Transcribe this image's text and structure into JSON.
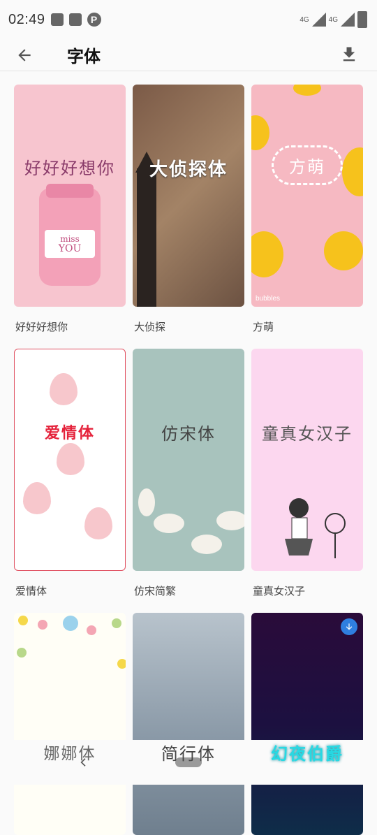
{
  "status_bar": {
    "time": "02:49",
    "network_1": "4G",
    "network_2": "4G"
  },
  "app_bar": {
    "title": "字体",
    "back_icon": "arrow-left-icon",
    "download_icon": "download-icon"
  },
  "fonts": [
    {
      "label": "好好好想你",
      "sample": "好好好想你"
    },
    {
      "label": "大侦探",
      "sample": "大侦探体"
    },
    {
      "label": "方萌",
      "sample": "方萌"
    },
    {
      "label": "爱情体",
      "sample": "爱情体"
    },
    {
      "label": "仿宋简繁",
      "sample": "仿宋体"
    },
    {
      "label": "童真女汉子",
      "sample": "童真女汉子"
    },
    {
      "label": "",
      "sample": "娜娜体"
    },
    {
      "label": "",
      "sample": "简行体"
    },
    {
      "label": "",
      "sample": "幻夜伯爵"
    }
  ],
  "thumb_extras": {
    "jar_text_1": "miss",
    "jar_text_2": "YOU",
    "bubbles_text": "bubbles"
  },
  "colors": {
    "accent": "#2f7fe0",
    "love_red": "#e5223b",
    "cyan_text": "#27d9e3"
  }
}
